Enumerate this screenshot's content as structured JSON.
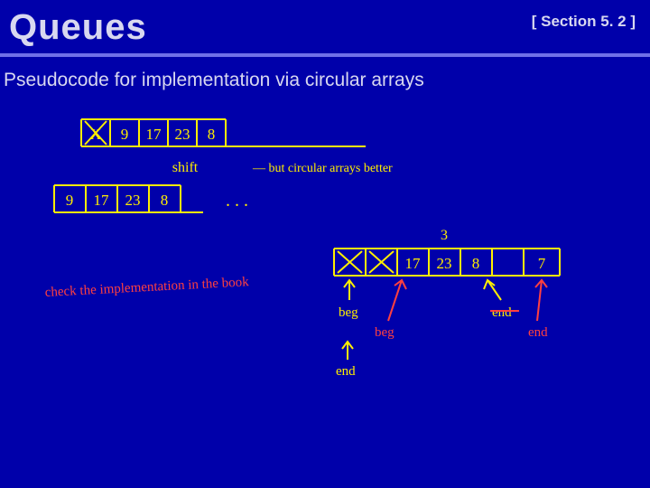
{
  "header": {
    "title": "Queues",
    "section": "[ Section 5. 2 ]"
  },
  "subtitle": "Pseudocode for implementation via circular arrays",
  "arrays": {
    "a1_cells": [
      "X",
      "9",
      "17",
      "23",
      "8"
    ],
    "a2_cells": [
      "9",
      "17",
      "23",
      "8"
    ],
    "a3_cells": [
      "X",
      "X",
      "17",
      "23",
      "8",
      "",
      "7"
    ]
  },
  "annotations": {
    "shift": "shift",
    "comment": "— but circular arrays better",
    "ellipsis": ". . .",
    "check": "check the implementation in the book",
    "three": "3",
    "beg1": "beg",
    "beg2": "beg",
    "end1": "end",
    "end2": "end",
    "end3": "end"
  }
}
